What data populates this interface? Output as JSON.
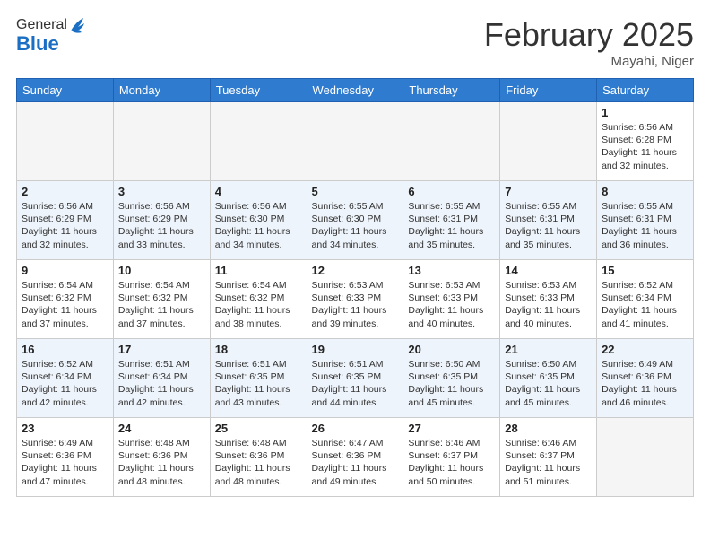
{
  "logo": {
    "general": "General",
    "blue": "Blue"
  },
  "header": {
    "month": "February 2025",
    "location": "Mayahi, Niger"
  },
  "days_of_week": [
    "Sunday",
    "Monday",
    "Tuesday",
    "Wednesday",
    "Thursday",
    "Friday",
    "Saturday"
  ],
  "weeks": [
    [
      {
        "day": "",
        "info": ""
      },
      {
        "day": "",
        "info": ""
      },
      {
        "day": "",
        "info": ""
      },
      {
        "day": "",
        "info": ""
      },
      {
        "day": "",
        "info": ""
      },
      {
        "day": "",
        "info": ""
      },
      {
        "day": "1",
        "info": "Sunrise: 6:56 AM\nSunset: 6:28 PM\nDaylight: 11 hours\nand 32 minutes."
      }
    ],
    [
      {
        "day": "2",
        "info": "Sunrise: 6:56 AM\nSunset: 6:29 PM\nDaylight: 11 hours\nand 32 minutes."
      },
      {
        "day": "3",
        "info": "Sunrise: 6:56 AM\nSunset: 6:29 PM\nDaylight: 11 hours\nand 33 minutes."
      },
      {
        "day": "4",
        "info": "Sunrise: 6:56 AM\nSunset: 6:30 PM\nDaylight: 11 hours\nand 34 minutes."
      },
      {
        "day": "5",
        "info": "Sunrise: 6:55 AM\nSunset: 6:30 PM\nDaylight: 11 hours\nand 34 minutes."
      },
      {
        "day": "6",
        "info": "Sunrise: 6:55 AM\nSunset: 6:31 PM\nDaylight: 11 hours\nand 35 minutes."
      },
      {
        "day": "7",
        "info": "Sunrise: 6:55 AM\nSunset: 6:31 PM\nDaylight: 11 hours\nand 35 minutes."
      },
      {
        "day": "8",
        "info": "Sunrise: 6:55 AM\nSunset: 6:31 PM\nDaylight: 11 hours\nand 36 minutes."
      }
    ],
    [
      {
        "day": "9",
        "info": "Sunrise: 6:54 AM\nSunset: 6:32 PM\nDaylight: 11 hours\nand 37 minutes."
      },
      {
        "day": "10",
        "info": "Sunrise: 6:54 AM\nSunset: 6:32 PM\nDaylight: 11 hours\nand 37 minutes."
      },
      {
        "day": "11",
        "info": "Sunrise: 6:54 AM\nSunset: 6:32 PM\nDaylight: 11 hours\nand 38 minutes."
      },
      {
        "day": "12",
        "info": "Sunrise: 6:53 AM\nSunset: 6:33 PM\nDaylight: 11 hours\nand 39 minutes."
      },
      {
        "day": "13",
        "info": "Sunrise: 6:53 AM\nSunset: 6:33 PM\nDaylight: 11 hours\nand 40 minutes."
      },
      {
        "day": "14",
        "info": "Sunrise: 6:53 AM\nSunset: 6:33 PM\nDaylight: 11 hours\nand 40 minutes."
      },
      {
        "day": "15",
        "info": "Sunrise: 6:52 AM\nSunset: 6:34 PM\nDaylight: 11 hours\nand 41 minutes."
      }
    ],
    [
      {
        "day": "16",
        "info": "Sunrise: 6:52 AM\nSunset: 6:34 PM\nDaylight: 11 hours\nand 42 minutes."
      },
      {
        "day": "17",
        "info": "Sunrise: 6:51 AM\nSunset: 6:34 PM\nDaylight: 11 hours\nand 42 minutes."
      },
      {
        "day": "18",
        "info": "Sunrise: 6:51 AM\nSunset: 6:35 PM\nDaylight: 11 hours\nand 43 minutes."
      },
      {
        "day": "19",
        "info": "Sunrise: 6:51 AM\nSunset: 6:35 PM\nDaylight: 11 hours\nand 44 minutes."
      },
      {
        "day": "20",
        "info": "Sunrise: 6:50 AM\nSunset: 6:35 PM\nDaylight: 11 hours\nand 45 minutes."
      },
      {
        "day": "21",
        "info": "Sunrise: 6:50 AM\nSunset: 6:35 PM\nDaylight: 11 hours\nand 45 minutes."
      },
      {
        "day": "22",
        "info": "Sunrise: 6:49 AM\nSunset: 6:36 PM\nDaylight: 11 hours\nand 46 minutes."
      }
    ],
    [
      {
        "day": "23",
        "info": "Sunrise: 6:49 AM\nSunset: 6:36 PM\nDaylight: 11 hours\nand 47 minutes."
      },
      {
        "day": "24",
        "info": "Sunrise: 6:48 AM\nSunset: 6:36 PM\nDaylight: 11 hours\nand 48 minutes."
      },
      {
        "day": "25",
        "info": "Sunrise: 6:48 AM\nSunset: 6:36 PM\nDaylight: 11 hours\nand 48 minutes."
      },
      {
        "day": "26",
        "info": "Sunrise: 6:47 AM\nSunset: 6:36 PM\nDaylight: 11 hours\nand 49 minutes."
      },
      {
        "day": "27",
        "info": "Sunrise: 6:46 AM\nSunset: 6:37 PM\nDaylight: 11 hours\nand 50 minutes."
      },
      {
        "day": "28",
        "info": "Sunrise: 6:46 AM\nSunset: 6:37 PM\nDaylight: 11 hours\nand 51 minutes."
      },
      {
        "day": "",
        "info": ""
      }
    ]
  ]
}
